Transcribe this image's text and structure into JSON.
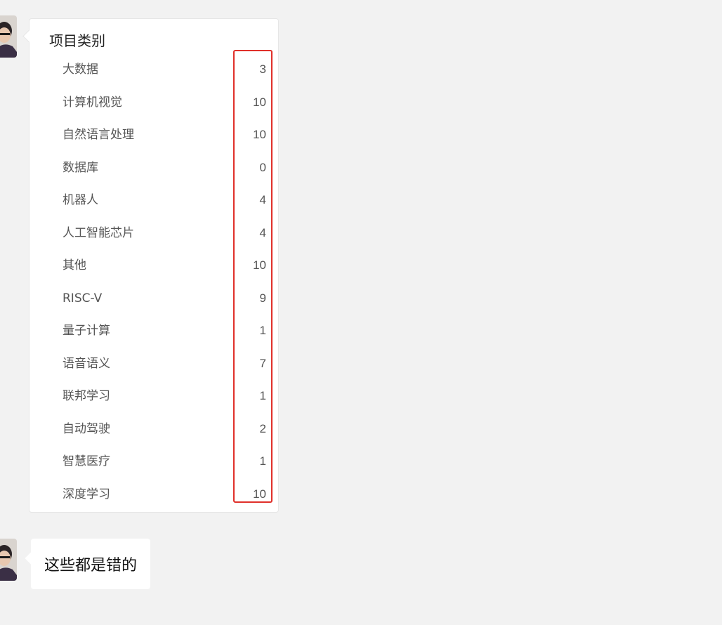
{
  "card": {
    "title": "项目类别",
    "rows": [
      {
        "label": "大数据",
        "count": "3"
      },
      {
        "label": "计算机视觉",
        "count": "10"
      },
      {
        "label": "自然语言处理",
        "count": "10"
      },
      {
        "label": "数据库",
        "count": "0"
      },
      {
        "label": "机器人",
        "count": "4"
      },
      {
        "label": "人工智能芯片",
        "count": "4"
      },
      {
        "label": "其他",
        "count": "10"
      },
      {
        "label": "RISC-V",
        "count": "9"
      },
      {
        "label": "量子计算",
        "count": "1"
      },
      {
        "label": "语音语义",
        "count": "7"
      },
      {
        "label": "联邦学习",
        "count": "1"
      },
      {
        "label": "自动驾驶",
        "count": "2"
      },
      {
        "label": "智慧医疗",
        "count": "1"
      },
      {
        "label": "深度学习",
        "count": "10"
      }
    ],
    "highlight_color": "#e0302a"
  },
  "message": {
    "text": "这些都是错的"
  },
  "icons": {
    "avatar": "user-avatar-icon"
  }
}
